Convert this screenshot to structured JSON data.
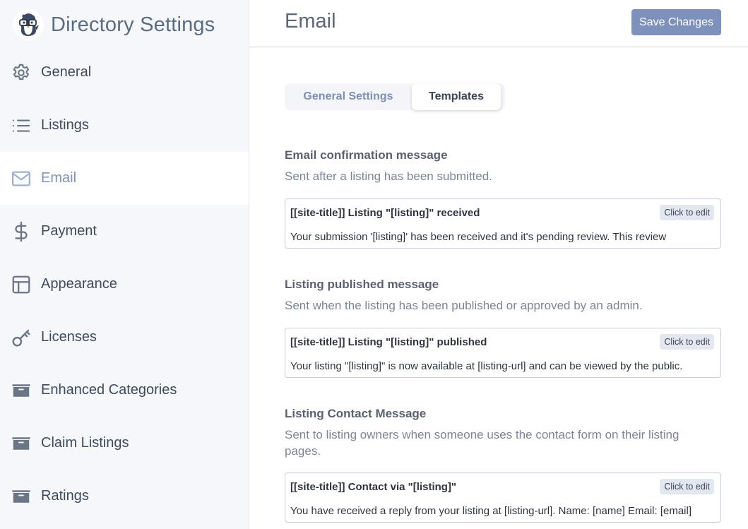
{
  "sidebar": {
    "brand_title": "Directory Settings",
    "logo_icon": "penguin-mascot-logo",
    "items": [
      {
        "label": "General",
        "icon": "gear-icon",
        "active": false
      },
      {
        "label": "Listings",
        "icon": "list-icon",
        "active": false
      },
      {
        "label": "Email",
        "icon": "envelope-icon",
        "active": true
      },
      {
        "label": "Payment",
        "icon": "dollar-icon",
        "active": false
      },
      {
        "label": "Appearance",
        "icon": "layout-icon",
        "active": false
      },
      {
        "label": "Licenses",
        "icon": "key-icon",
        "active": false
      },
      {
        "label": "Enhanced Categories",
        "icon": "archive-box-icon",
        "active": false
      },
      {
        "label": "Claim Listings",
        "icon": "archive-box-icon",
        "active": false
      },
      {
        "label": "Ratings",
        "icon": "archive-box-icon",
        "active": false
      }
    ]
  },
  "header": {
    "title": "Email",
    "save_label": "Save Changes"
  },
  "tabs": [
    {
      "label": "General Settings",
      "active": false
    },
    {
      "label": "Templates",
      "active": true
    }
  ],
  "templates": [
    {
      "title": "Email confirmation message",
      "description": "Sent after a listing has been submitted.",
      "subject": "[[site-title]] Listing \"[listing]\" received",
      "body": "Your submission '[listing]' has been received and it's pending review. This review",
      "edit_label": "Click to edit"
    },
    {
      "title": "Listing published message",
      "description": "Sent when the listing has been published or approved by an admin.",
      "subject": "[[site-title]] Listing \"[listing]\" published",
      "body": "Your listing \"[listing]\" is now available at [listing-url] and can be viewed by the public.",
      "edit_label": "Click to edit"
    },
    {
      "title": "Listing Contact Message",
      "description": "Sent to listing owners when someone uses the contact form on their listing pages.",
      "subject": "[[site-title]] Contact via \"[listing]\"",
      "body": "You have received a reply from your listing at [listing-url]. Name: [name] Email: [email]",
      "edit_label": "Click to edit"
    }
  ],
  "colors": {
    "accent": "#7e91bd",
    "sidebar_bg": "#f5f7fa",
    "active_text": "#7e92b9"
  }
}
